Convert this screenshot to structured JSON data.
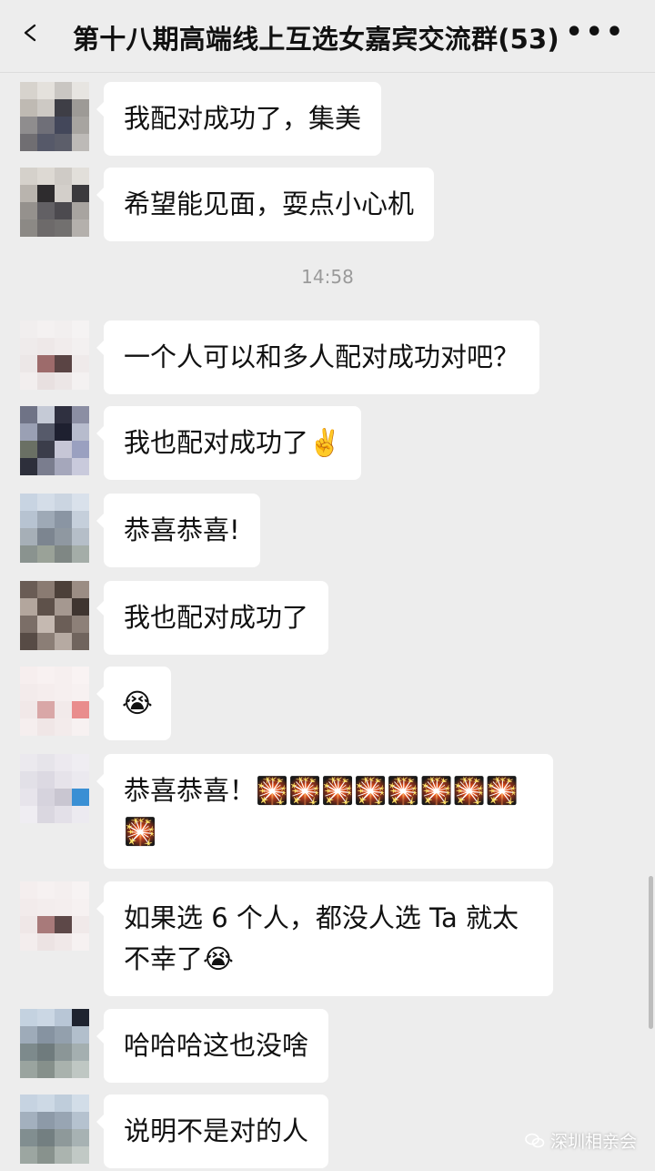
{
  "header": {
    "title": "第十八期高端线上互选女嘉宾交流群(53)",
    "more": "•••"
  },
  "messages": [
    {
      "text": "我配对成功了，集美"
    },
    {
      "text": "希望能见面，耍点小心机"
    },
    {
      "text": "一个人可以和多人配对成功对吧？"
    },
    {
      "text": "我也配对成功了✌️"
    },
    {
      "text": "恭喜恭喜!"
    },
    {
      "text": "我也配对成功了"
    },
    {
      "text": "😭"
    },
    {
      "text": "恭喜恭喜！🎇🎇🎇🎇🎇🎇🎇🎇🎇"
    },
    {
      "text": "如果选 6 个人，都没人选 Ta 就太不幸了😭"
    },
    {
      "text": "哈哈哈这也没啥"
    },
    {
      "text": "说明不是对的人"
    }
  ],
  "timestamp": "14:58",
  "watermark": "深圳相亲会",
  "colors": {
    "background": "#ededed",
    "bubble": "#ffffff",
    "timestamp": "#9a9a9a"
  }
}
